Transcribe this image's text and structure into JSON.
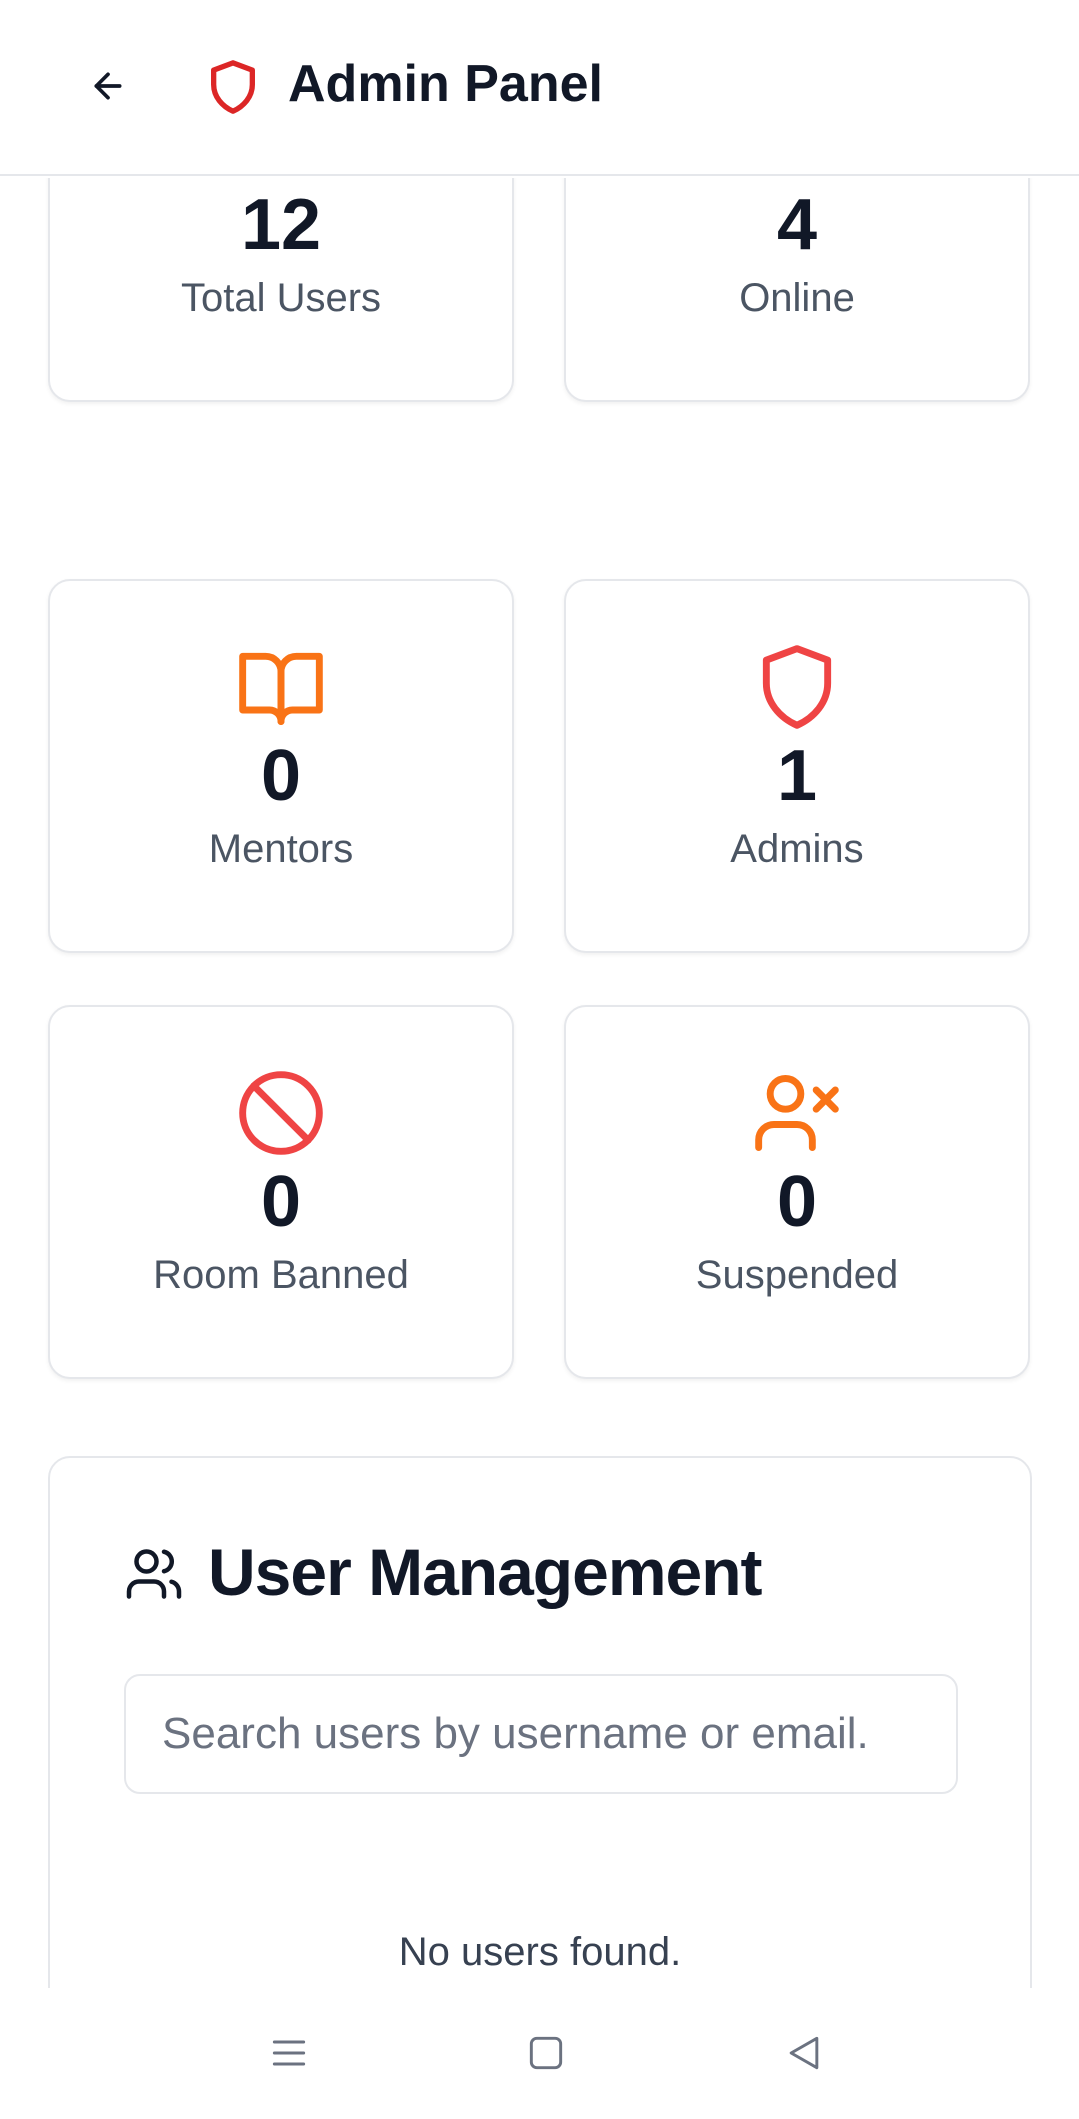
{
  "header": {
    "title": "Admin Panel",
    "back_icon": "arrow-left-icon",
    "shield_icon": "shield-icon",
    "shield_color": "#dc2626"
  },
  "stats": [
    {
      "value": "12",
      "label": "Total Users",
      "icon": "users-icon",
      "color": "#3b82f6"
    },
    {
      "value": "4",
      "label": "Online",
      "icon": "activity-icon",
      "color": "#22c55e"
    },
    {
      "value": "0",
      "label": "Mentors",
      "icon": "book-open-icon",
      "color": "#f97316"
    },
    {
      "value": "1",
      "label": "Admins",
      "icon": "shield-icon",
      "color": "#ef4444"
    },
    {
      "value": "0",
      "label": "Room Banned",
      "icon": "ban-icon",
      "color": "#ef4444"
    },
    {
      "value": "0",
      "label": "Suspended",
      "icon": "user-x-icon",
      "color": "#f97316"
    }
  ],
  "user_management": {
    "title": "User Management",
    "icon": "users-icon",
    "search": {
      "placeholder": "Search users by username or email.",
      "value": ""
    },
    "empty_message": "No users found."
  },
  "system_nav": {
    "menu_icon": "menu-icon",
    "home_icon": "home-square-icon",
    "back_icon": "back-triangle-icon"
  }
}
